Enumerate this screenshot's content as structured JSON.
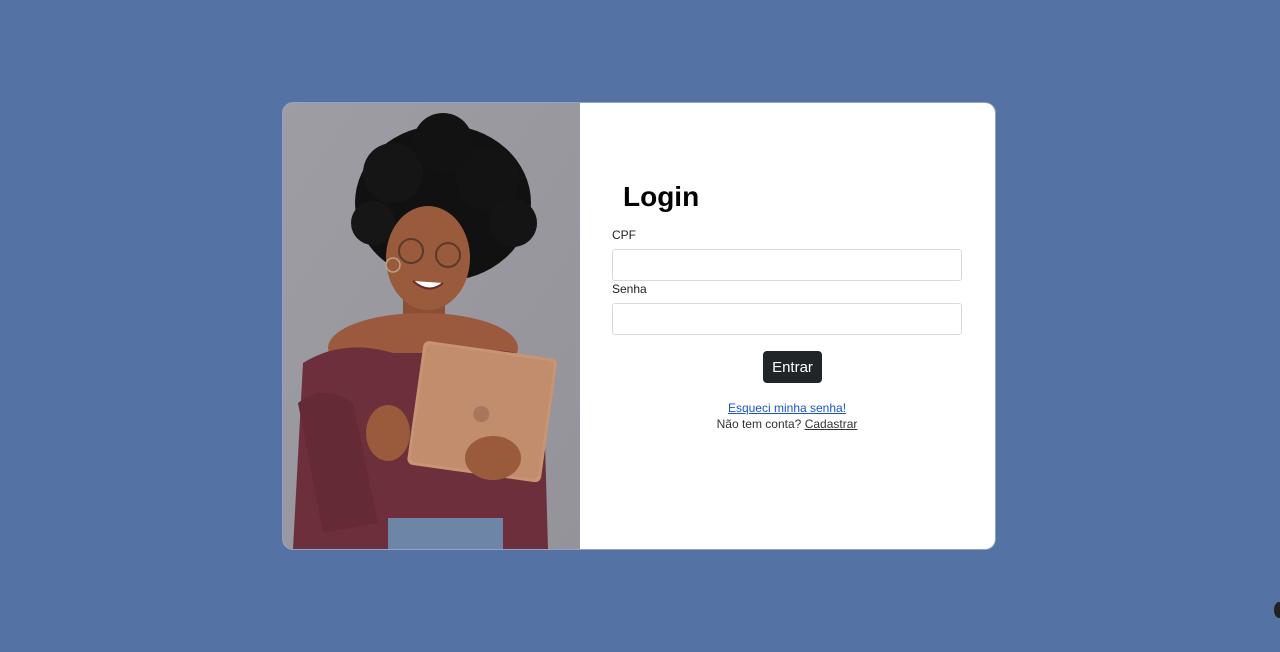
{
  "login": {
    "title": "Login",
    "cpf_label": "CPF",
    "cpf_value": "",
    "senha_label": "Senha",
    "senha_value": "",
    "submit_label": "Entrar",
    "forgot_link": "Esqueci minha senha!",
    "no_account_text": "Não tem conta?",
    "signup_link": "Cadastrar"
  },
  "colors": {
    "background": "#5472a3",
    "card": "#ffffff",
    "button": "#212529",
    "link": "#1a56c9"
  },
  "image": {
    "icon": "woman-with-tablet-photo"
  }
}
